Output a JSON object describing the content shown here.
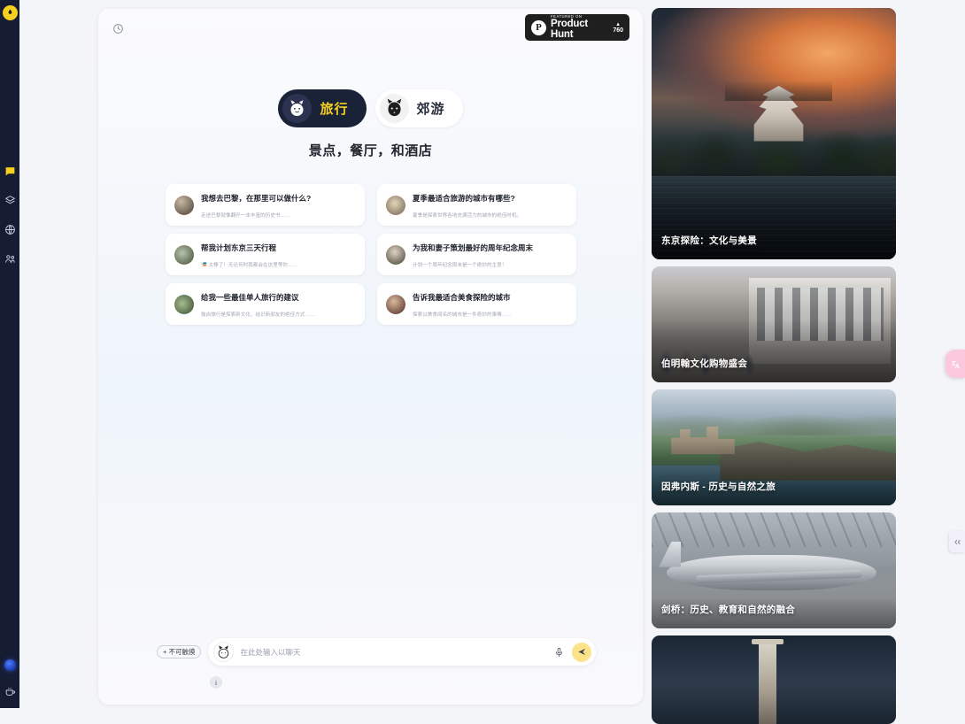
{
  "left_rail": {
    "logo_icon": "flame-logo-icon",
    "items": [
      {
        "icon": "chat-bubble-icon",
        "name": "rail-item-chat"
      },
      {
        "icon": "layers-icon",
        "name": "rail-item-layers"
      },
      {
        "icon": "globe-icon",
        "name": "rail-item-discover"
      },
      {
        "icon": "people-icon",
        "name": "rail-item-community"
      }
    ],
    "bottom_items": [
      {
        "icon": "status-dot-icon",
        "name": "rail-item-status"
      },
      {
        "icon": "coffee-cup-icon",
        "name": "rail-item-coffee"
      }
    ]
  },
  "chat_panel": {
    "refresh_icon": "refresh-clock-icon",
    "product_hunt": {
      "featured_label": "FEATURED ON",
      "name": "Product Hunt",
      "logo_letter": "P",
      "caret": "▲",
      "votes": "760"
    },
    "modes": [
      {
        "label": "旅行",
        "icon": "cat-avatar-icon",
        "active": true
      },
      {
        "label": "郊游",
        "icon": "fox-avatar-icon",
        "active": false
      }
    ],
    "headline": "景点，餐厅，和酒店",
    "suggestions": [
      {
        "title": "我想去巴黎，在那里可以做什么?",
        "subtitle": "走进巴黎就像翻开一本丰富的历史书……",
        "thumb": "paris-thumb"
      },
      {
        "title": "夏季最适合旅游的城市有哪些?",
        "subtitle": "夏季是探索世界各地充满活力的城市的绝佳时机。",
        "thumb": "summer-city-thumb"
      },
      {
        "title": "帮我计划东京三天行程",
        "subtitle": "🎏 太棒了！无论何时我都会在这里等你……",
        "thumb": "tokyo-thumb"
      },
      {
        "title": "为我和妻子策划最好的周年纪念周末",
        "subtitle": "计划一个周年纪念周末是一个绝妙的主意！",
        "thumb": "anniversary-thumb"
      },
      {
        "title": "给我一些最佳单人旅行的建议",
        "subtitle": "独自旅行是探索新文化、结识新朋友的绝佳方式……",
        "thumb": "solo-travel-thumb"
      },
      {
        "title": "告诉我最适合美食探险的城市",
        "subtitle": "探索以美食闻名的城市是一件奇妙的事情……",
        "thumb": "food-thumb"
      }
    ],
    "composer": {
      "untouchable_chip": "+ 不可触摸",
      "avatar_icon": "cat-avatar-icon",
      "placeholder": "在此处输入以聊天",
      "value": "",
      "mic_icon": "microphone-icon",
      "send_icon": "send-paper-plane-icon"
    },
    "info_button": "i"
  },
  "photo_cards": [
    {
      "caption": "东京探险：文化与美景",
      "name": "photo-card-tokyo"
    },
    {
      "caption": "伯明翰文化购物盛会",
      "name": "photo-card-birmingham"
    },
    {
      "caption": "因弗内斯 - 历史与自然之旅",
      "name": "photo-card-inverness"
    },
    {
      "caption": "剑桥：历史、教育和自然的融合",
      "name": "photo-card-cambridge"
    },
    {
      "caption": "",
      "name": "photo-card-monument"
    }
  ],
  "floating_buttons": [
    {
      "icon": "translate-icon",
      "name": "translate-fab",
      "color": "#fbc8dd"
    },
    {
      "icon": "collapse-panel-icon",
      "name": "collapse-panel-fab",
      "color": "#f2f0f8"
    }
  ]
}
